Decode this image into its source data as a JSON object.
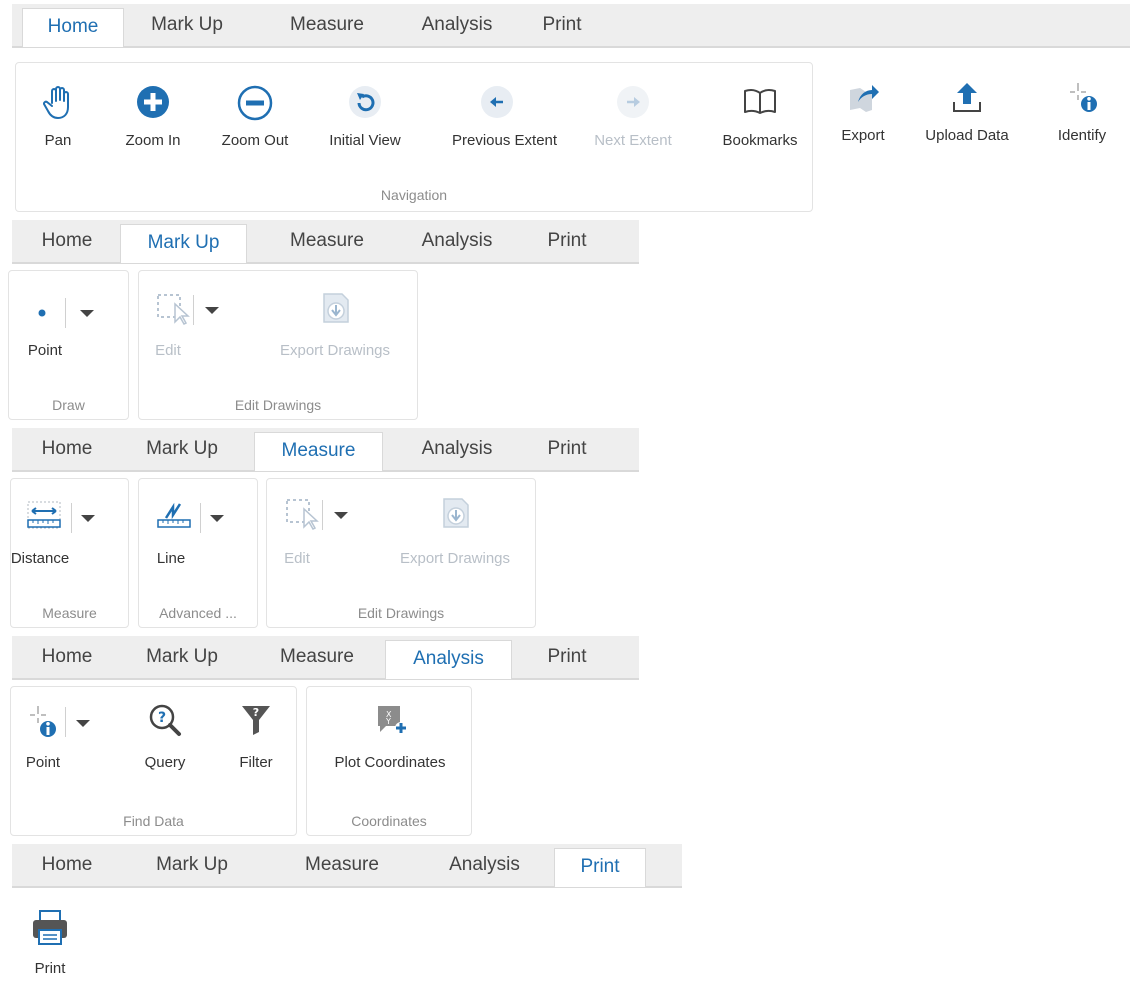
{
  "tabs": [
    "Home",
    "Mark Up",
    "Measure",
    "Analysis",
    "Print"
  ],
  "home": {
    "navigation_group": "Navigation",
    "tools": {
      "pan": "Pan",
      "zoom_in": "Zoom In",
      "zoom_out": "Zoom Out",
      "initial_view": "Initial View",
      "previous_extent": "Previous Extent",
      "next_extent": "Next Extent",
      "bookmarks": "Bookmarks",
      "export": "Export",
      "upload_data": "Upload Data",
      "identify": "Identify"
    }
  },
  "markup": {
    "draw_group": "Draw",
    "edit_group": "Edit Drawings",
    "point": "Point",
    "edit": "Edit",
    "export_drawings": "Export Drawings"
  },
  "measure": {
    "measure_group": "Measure",
    "advanced_group": "Advanced ...",
    "edit_group": "Edit Drawings",
    "distance": "Distance",
    "line": "Line",
    "edit": "Edit",
    "export_drawings": "Export Drawings"
  },
  "analysis": {
    "find_group": "Find Data",
    "coords_group": "Coordinates",
    "point": "Point",
    "query": "Query",
    "filter": "Filter",
    "plot_coordinates": "Plot Coordinates"
  },
  "print": {
    "print": "Print"
  },
  "colors": {
    "accent": "#1f6fb2",
    "disabled": "#b8bfc7",
    "tab_bg": "#eeeeee"
  }
}
